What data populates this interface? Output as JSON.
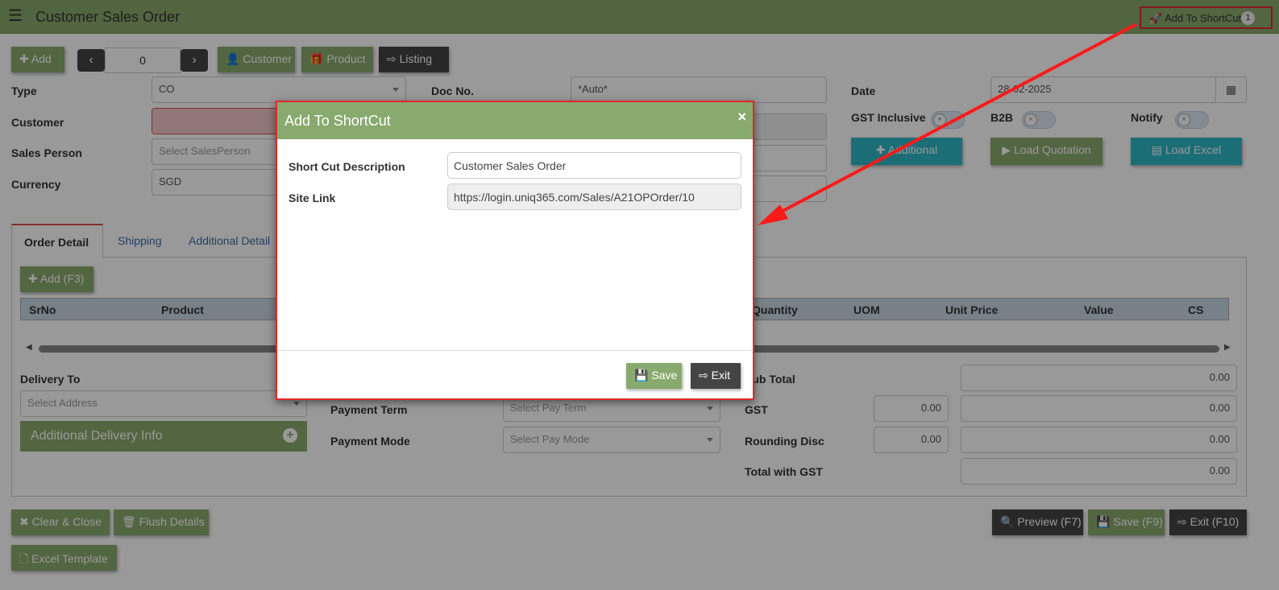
{
  "header": {
    "title": "Customer Sales Order",
    "shortcut_label": "Add To ShortCut",
    "shortcut_badge": "1"
  },
  "toolbar": {
    "add": "Add",
    "record_no": "0",
    "customer": "Customer",
    "product": "Product",
    "listing": "Listing"
  },
  "form": {
    "type_label": "Type",
    "type_value": "CO",
    "customer_label": "Customer",
    "sales_person_label": "Sales Person",
    "sales_person_placeholder": "Select SalesPerson",
    "currency_label": "Currency",
    "currency_value": "SGD",
    "doc_no_label": "Doc No.",
    "doc_no_value": "*Auto*",
    "date_label": "Date",
    "date_value": "28-02-2025",
    "gst_inclusive_label": "GST Inclusive",
    "b2b_label": "B2B",
    "notify_label": "Notify",
    "additional": "Additional",
    "load_quotation": "Load Quotation",
    "load_excel": "Load Excel"
  },
  "tabs": [
    "Order Detail",
    "Shipping",
    "Additional Detail"
  ],
  "detail": {
    "add_f3": "Add (F3)",
    "columns": [
      "SrNo",
      "Product",
      "Quantity",
      "UOM",
      "Unit Price",
      "Value",
      "CS"
    ]
  },
  "delivery": {
    "label": "Delivery To",
    "placeholder": "Select Address",
    "additional_info": "Additional Delivery Info",
    "payment_term_label": "Payment Term",
    "payment_term_placeholder": "Select Pay Term",
    "payment_mode_label": "Payment Mode",
    "payment_mode_placeholder": "Select Pay Mode"
  },
  "totals": {
    "sub_total_label": "Sub Total",
    "sub_total": "0.00",
    "gst_label": "GST",
    "gst_rate": "0.00",
    "gst": "0.00",
    "rounding_label": "Rounding Disc",
    "rounding_input": "0.00",
    "rounding": "0.00",
    "total_label": "Total with GST",
    "total": "0.00"
  },
  "footer": {
    "clear_close": "Clear & Close",
    "flush_details": "Flush Details",
    "excel_template": "Excel Template",
    "preview": "Preview (F7)",
    "save": "Save (F9)",
    "exit": "Exit (F10)"
  },
  "modal": {
    "title": "Add To ShortCut",
    "desc_label": "Short Cut Description",
    "desc_value": "Customer Sales Order",
    "link_label": "Site Link",
    "link_value": "https://login.uniq365.com/Sales/A21OPOrder/10",
    "save": "Save",
    "exit": "Exit"
  },
  "colors": {
    "accent": "#89aa6e",
    "dark": "#444444",
    "teal": "#2eb7c5",
    "highlight": "#e0282a"
  }
}
